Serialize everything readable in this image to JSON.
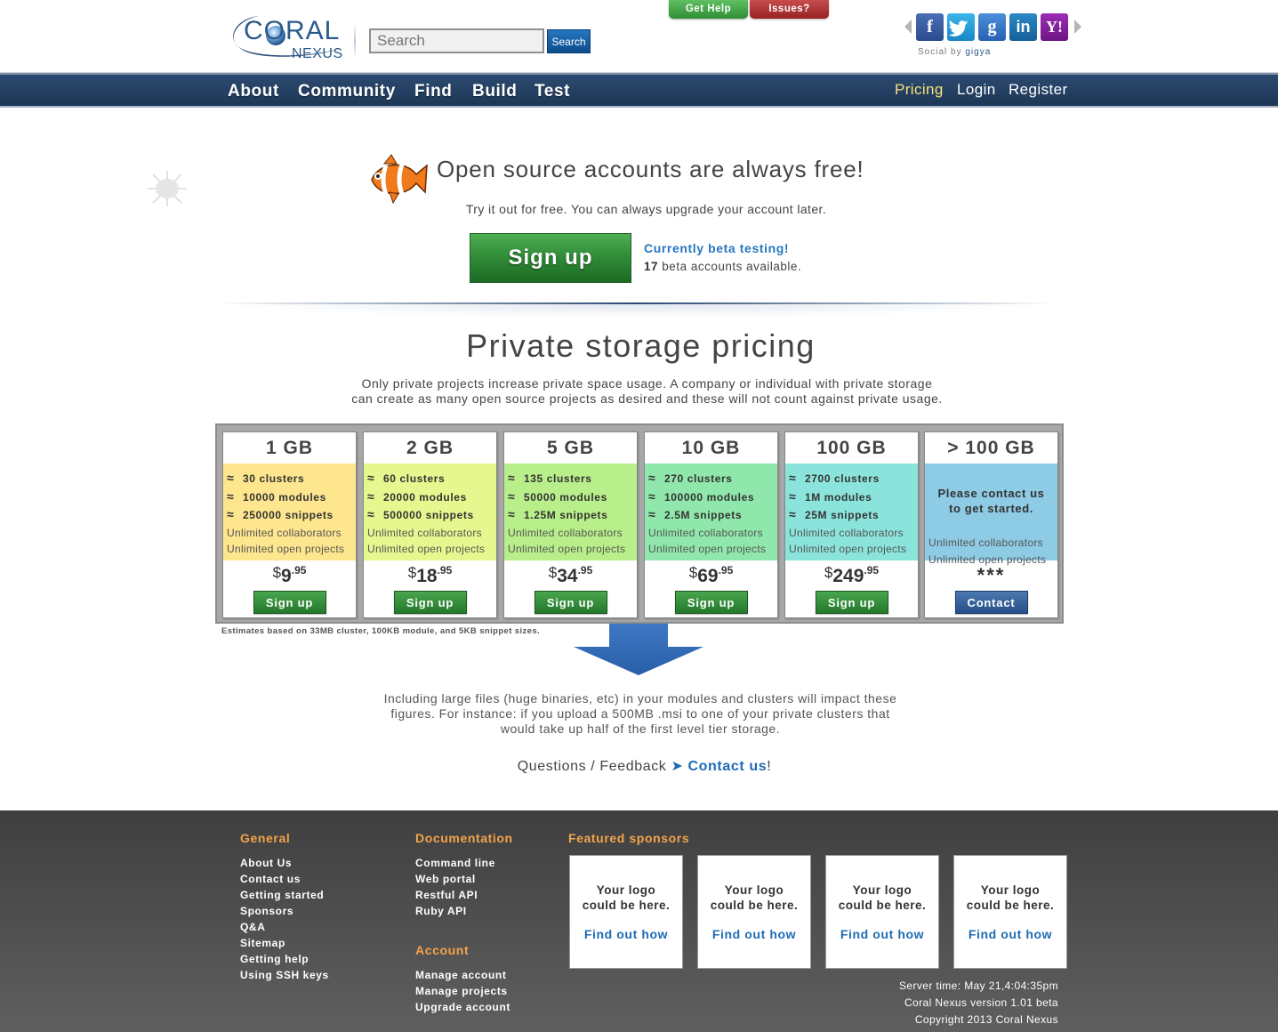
{
  "header": {
    "logo_main": "CORAL",
    "logo_sub": "NEXUS",
    "search_placeholder": "Search",
    "search_button": "Search",
    "get_help": "Get Help",
    "issues": "Issues?",
    "social_by_prefix": "Social by",
    "social_by_brand": "gigya",
    "social": [
      "facebook-icon",
      "twitter-icon",
      "google-icon",
      "linkedin-icon",
      "yahoo-icon"
    ]
  },
  "nav": {
    "left": [
      "About",
      "Community",
      "Find",
      "Build",
      "Test"
    ],
    "right": [
      "Pricing",
      "Login",
      "Register"
    ],
    "active": "Pricing"
  },
  "hero": {
    "title": "Open source accounts are always free!",
    "subtitle": "Try it out for free. You can always upgrade your account later.",
    "signup_button": "Sign up",
    "beta_title": "Currently beta testing!",
    "beta_count": "17",
    "beta_suffix": "beta accounts available."
  },
  "pricing": {
    "title": "Private storage pricing",
    "desc_line1": "Only private projects increase private space usage.  A company or individual with private storage",
    "desc_line2": "can create as many open source projects as desired and these will not count against private usage.",
    "tiers": [
      {
        "size": "1 GB",
        "color": "#fde68d",
        "features": [
          "30 clusters",
          "10000 modules",
          "250000 snippets"
        ],
        "extras": [
          "Unlimited collaborators",
          "Unlimited open projects"
        ],
        "currency": "$",
        "amount": "9",
        "cents": ".95",
        "button": "Sign up"
      },
      {
        "size": "2 GB",
        "color": "#e5f78e",
        "features": [
          "60 clusters",
          "20000 modules",
          "500000 snippets"
        ],
        "extras": [
          "Unlimited collaborators",
          "Unlimited open projects"
        ],
        "currency": "$",
        "amount": "18",
        "cents": ".95",
        "button": "Sign up"
      },
      {
        "size": "5 GB",
        "color": "#b9ef8a",
        "features": [
          "135 clusters",
          "50000 modules",
          "1.25M snippets"
        ],
        "extras": [
          "Unlimited collaborators",
          "Unlimited open projects"
        ],
        "currency": "$",
        "amount": "34",
        "cents": ".95",
        "button": "Sign up"
      },
      {
        "size": "10 GB",
        "color": "#90e7ab",
        "features": [
          "270 clusters",
          "100000 modules",
          "2.5M snippets"
        ],
        "extras": [
          "Unlimited collaborators",
          "Unlimited open projects"
        ],
        "currency": "$",
        "amount": "69",
        "cents": ".95",
        "button": "Sign up"
      },
      {
        "size": "100 GB",
        "color": "#8be4db",
        "features": [
          "2700 clusters",
          "1M modules",
          "25M snippets"
        ],
        "extras": [
          "Unlimited collaborators",
          "Unlimited open projects"
        ],
        "currency": "$",
        "amount": "249",
        "cents": ".95",
        "button": "Sign up"
      },
      {
        "size": "> 100 GB",
        "color": "#8ecbe5",
        "contact_line1": "Please contact us",
        "contact_line2": "to get started.",
        "extras": [
          "Unlimited collaborators",
          "Unlimited open projects"
        ],
        "price_text": "***",
        "button": "Contact"
      }
    ],
    "approx_symbol": "≈",
    "estimate_note": "Estimates based on 33MB cluster, 100KB module, and 5KB snippet sizes."
  },
  "impact": {
    "line1": "Including large files (huge binaries, etc) in your modules and clusters will impact these",
    "line2": "figures.  For instance: if you upload a 500MB .msi to one of your private clusters that",
    "line3": "would take up half of the first level tier storage."
  },
  "questions": {
    "prefix": "Questions / Feedback",
    "arrow": "➤",
    "link": "Contact us",
    "suffix": "!"
  },
  "footer": {
    "general_title": "General",
    "general_links": [
      "About Us",
      "Contact us",
      "Getting started",
      "Sponsors",
      "Q&A",
      "Sitemap",
      "Getting help",
      "Using SSH keys"
    ],
    "docs_title": "Documentation",
    "docs_links": [
      "Command line",
      "Web portal",
      "Restful API",
      "Ruby API"
    ],
    "account_title": "Account",
    "account_links": [
      "Manage account",
      "Manage projects",
      "Upgrade account"
    ],
    "sponsors_title": "Featured sponsors",
    "sponsor_line1": "Your logo",
    "sponsor_line2": "could be here.",
    "sponsor_link": "Find out how",
    "server_time": "Server time: May 21,4:04:35pm",
    "version": "Coral Nexus version 1.01 beta",
    "copyright": "Copyright 2013 Coral Nexus"
  }
}
